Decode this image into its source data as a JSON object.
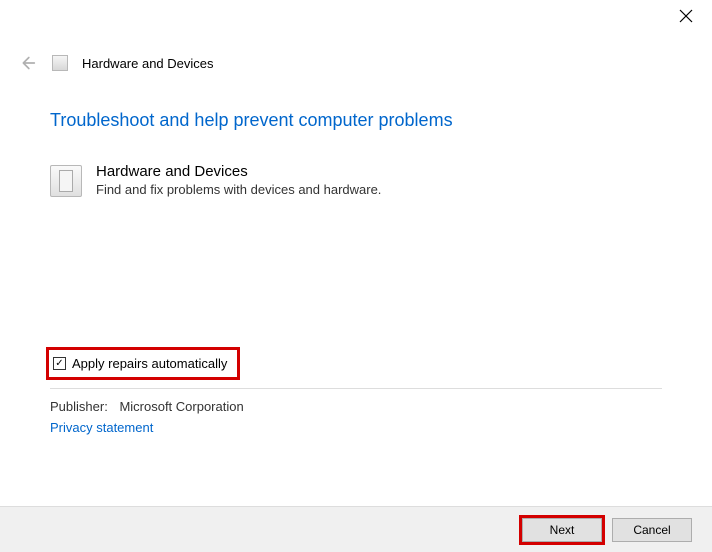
{
  "titlebar": {
    "close": "×"
  },
  "header": {
    "title": "Hardware and Devices"
  },
  "main": {
    "heading": "Troubleshoot and help prevent computer problems",
    "device_title": "Hardware and Devices",
    "device_desc": "Find and fix problems with devices and hardware."
  },
  "options": {
    "apply_repairs_label": "Apply repairs automatically",
    "checkmark": "✓"
  },
  "meta": {
    "publisher_label": "Publisher:",
    "publisher_value": "Microsoft Corporation",
    "privacy": "Privacy statement"
  },
  "footer": {
    "next": "Next",
    "cancel": "Cancel"
  }
}
